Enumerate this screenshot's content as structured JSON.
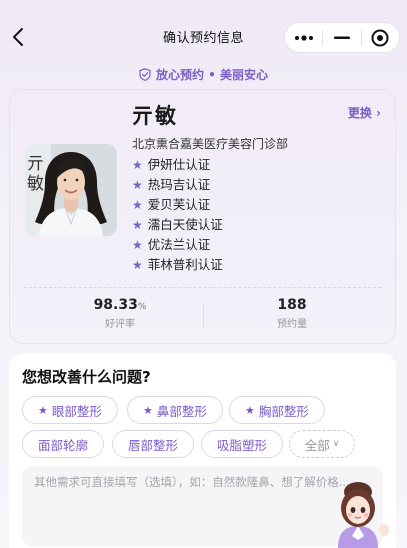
{
  "navbar": {
    "title": "确认预约信息",
    "back_icon": "chevron-left-icon",
    "menu_icon": "more-dots-icon",
    "minimize_icon": "minimize-icon",
    "close_icon": "target-close-icon"
  },
  "tagline": {
    "icon": "shield-check-icon",
    "text": "放心预约 • 美丽安心",
    "color": "#7b5fc7"
  },
  "doctor": {
    "photo_text": "亓敏",
    "name": "亓敏",
    "swap_label": "更换 ›",
    "clinic": "北京熏合嘉美医疗美容门诊部",
    "certifications": [
      "伊妍仕认证",
      "热玛吉认证",
      "爱贝芙认证",
      "濡白天使认证",
      "优法兰认证",
      "菲林普利认证"
    ],
    "stats": {
      "rating_value": "98.33",
      "rating_unit": "%",
      "rating_label": "好评率",
      "bookings_value": "188",
      "bookings_label": "预约量"
    }
  },
  "question": {
    "title": "您想改善什么问题?",
    "chips_row1": [
      "眼部整形",
      "鼻部整形",
      "胸部整形"
    ],
    "chips_row2": [
      "面部轮廓",
      "唇部整形",
      "吸脂塑形"
    ],
    "more_label": "全部",
    "note_placeholder": "其他需求可直接填写（选填），如：自然款隆鼻、想了解价格..."
  },
  "colors": {
    "accent": "#7a5bc9",
    "card_bg": "#f1ecf8",
    "page_bg": "#efe9f6"
  }
}
